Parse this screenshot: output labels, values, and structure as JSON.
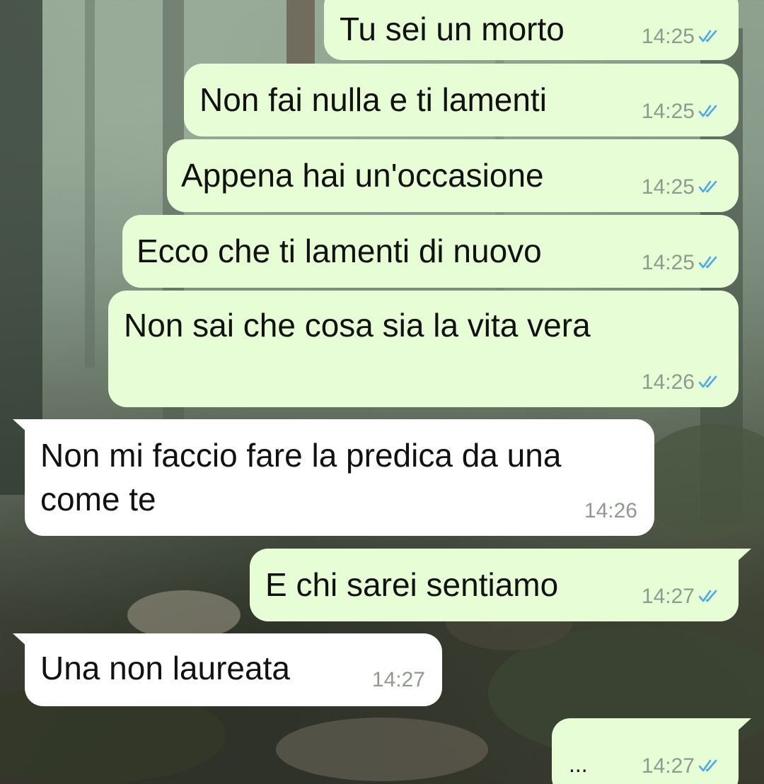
{
  "chat": {
    "messages": [
      {
        "direction": "outgoing",
        "text": "Tu sei un morto",
        "time": "14:25",
        "status": "read-double-check-icon"
      },
      {
        "direction": "outgoing",
        "text": "Non fai nulla e ti lamenti",
        "time": "14:25",
        "status": "read-double-check-icon"
      },
      {
        "direction": "outgoing",
        "text": "Appena hai un'occasione",
        "time": "14:25",
        "status": "read-double-check-icon"
      },
      {
        "direction": "outgoing",
        "text": "Ecco che ti lamenti di nuovo",
        "time": "14:25",
        "status": "read-double-check-icon"
      },
      {
        "direction": "outgoing",
        "text": "Non sai che cosa sia la vita vera",
        "time": "14:26",
        "status": "read-double-check-icon"
      },
      {
        "direction": "incoming",
        "text": "Non mi faccio fare la predica da una\ncome te",
        "time": "14:26"
      },
      {
        "direction": "outgoing",
        "text": "E chi sarei sentiamo",
        "time": "14:27",
        "status": "read-double-check-icon"
      },
      {
        "direction": "incoming",
        "text": "Una non laureata",
        "time": "14:27"
      },
      {
        "direction": "outgoing",
        "text": "...",
        "time": "14:27",
        "status": "read-double-check-icon"
      }
    ]
  },
  "colors": {
    "outgoing_bubble": "#e7fdd6",
    "incoming_bubble": "#ffffff",
    "read_ticks": "#4fa8e8",
    "timestamp": "#8e9a8e"
  }
}
